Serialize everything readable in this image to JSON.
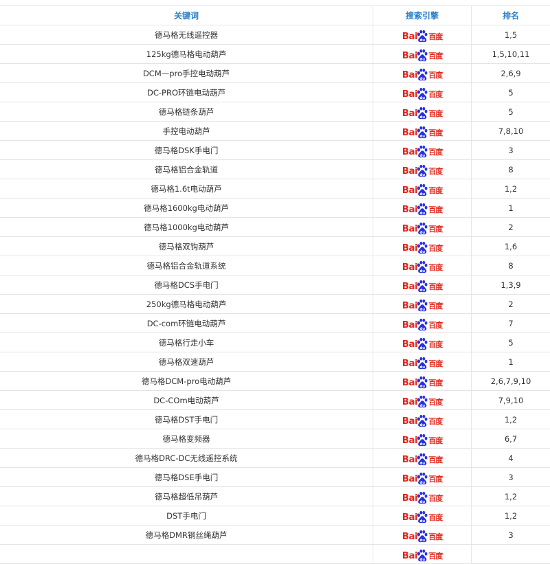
{
  "headers": {
    "keyword": "关键词",
    "engine": "搜索引擎",
    "rank": "排名"
  },
  "logo": {
    "text_left": "Bai",
    "text_right": "百度",
    "icon": "baidu-paw-icon",
    "color": "#e1251b"
  },
  "rows": [
    {
      "keyword": "德马格无线遥控器",
      "rank": "1,5"
    },
    {
      "keyword": "125kg德马格电动葫芦",
      "rank": "1,5,10,11"
    },
    {
      "keyword": "DCM—pro手控电动葫芦",
      "rank": "2,6,9"
    },
    {
      "keyword": "DC-PRO环链电动葫芦",
      "rank": "5"
    },
    {
      "keyword": "德马格链条葫芦",
      "rank": "5"
    },
    {
      "keyword": "手控电动葫芦",
      "rank": "7,8,10"
    },
    {
      "keyword": "德马格DSK手电门",
      "rank": "3"
    },
    {
      "keyword": "德马格铝合金轨道",
      "rank": "8"
    },
    {
      "keyword": "德马格1.6t电动葫芦",
      "rank": "1,2"
    },
    {
      "keyword": "德马格1600kg电动葫芦",
      "rank": "1"
    },
    {
      "keyword": "德马格1000kg电动葫芦",
      "rank": "2"
    },
    {
      "keyword": "德马格双钩葫芦",
      "rank": "1,6"
    },
    {
      "keyword": "德马格铝合金轨道系统",
      "rank": "8"
    },
    {
      "keyword": "德马格DCS手电门",
      "rank": "1,3,9"
    },
    {
      "keyword": "250kg德马格电动葫芦",
      "rank": "2"
    },
    {
      "keyword": "DC-com环链电动葫芦",
      "rank": "7"
    },
    {
      "keyword": "德马格行走小车",
      "rank": "5"
    },
    {
      "keyword": "德马格双速葫芦",
      "rank": "1"
    },
    {
      "keyword": "德马格DCM-pro电动葫芦",
      "rank": "2,6,7,9,10"
    },
    {
      "keyword": "DC-COm电动葫芦",
      "rank": "7,9,10"
    },
    {
      "keyword": "德马格DST手电门",
      "rank": "1,2"
    },
    {
      "keyword": "德马格变频器",
      "rank": "6,7"
    },
    {
      "keyword": "德马格DRC-DC无线遥控系统",
      "rank": "4"
    },
    {
      "keyword": "德马格DSE手电门",
      "rank": "3"
    },
    {
      "keyword": "德马格超低吊葫芦",
      "rank": "1,2"
    },
    {
      "keyword": "DST手电门",
      "rank": "1,2"
    },
    {
      "keyword": "德马格DMR钢丝绳葫芦",
      "rank": "3"
    },
    {
      "keyword": "",
      "rank": ""
    }
  ]
}
